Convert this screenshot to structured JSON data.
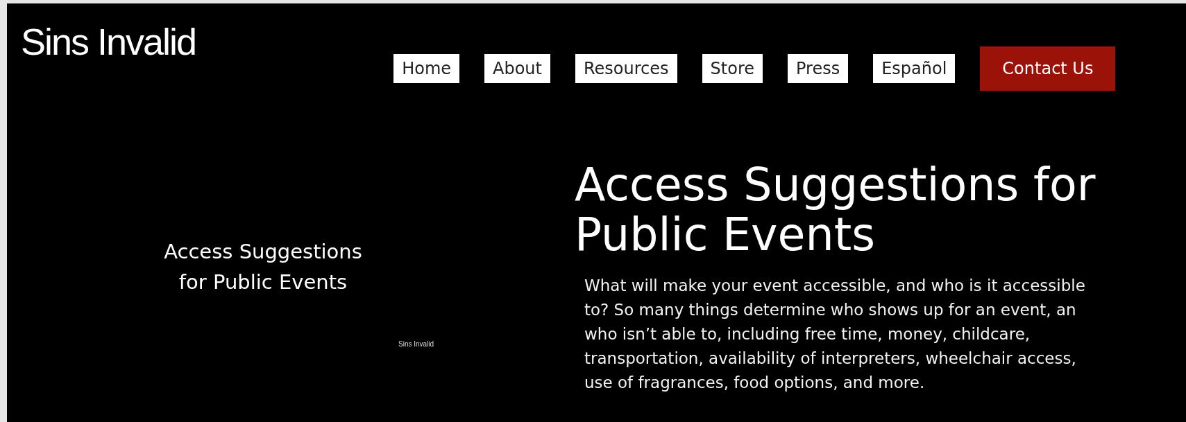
{
  "site": {
    "logo": "Sins Invalid"
  },
  "nav": [
    {
      "label": "Home",
      "kind": "link"
    },
    {
      "label": "About",
      "kind": "link"
    },
    {
      "label": "Resources",
      "kind": "link"
    },
    {
      "label": "Store",
      "kind": "link"
    },
    {
      "label": "Press",
      "kind": "link"
    },
    {
      "label": "Español",
      "kind": "link"
    },
    {
      "label": "Contact Us",
      "kind": "cta"
    }
  ],
  "feature_graphic": {
    "title_lines": [
      "Access Suggestions",
      "for Public Events"
    ],
    "credit": "Sins Invalid"
  },
  "article": {
    "title": "Access Suggestions for Public Events",
    "intro_lines": [
      "What will make your event accessible, and who is it accessible",
      "to? So many things determine who shows up for an event, an",
      "who isn’t able to, including free time, money, childcare,",
      "transportation, availability of interpreters, wheelchair access,",
      "use of fragrances, food options, and more."
    ]
  }
}
